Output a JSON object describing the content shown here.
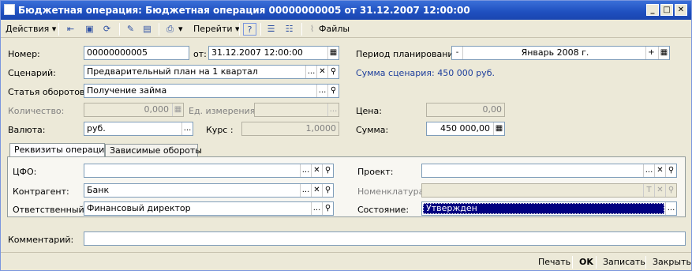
{
  "window": {
    "title": "Бюджетная операция: Бюджетная операция 00000000005 от 31.12.2007 12:00:00"
  },
  "toolbar": {
    "actions_label": "Действия",
    "goto_label": "Перейти",
    "files_label": "Файлы",
    "help_label": "?"
  },
  "fields": {
    "number_label": "Номер:",
    "number_value": "00000000005",
    "date_label": "от:",
    "date_value": "31.12.2007 12:00:00",
    "period_label": "Период планирования:",
    "period_value": "Январь 2008 г.",
    "scenario_label": "Сценарий:",
    "scenario_value": "Предварительный план на 1 квартал",
    "scenario_sum": "Сумма сценария: 450 000 руб.",
    "article_label": "Статья оборотов:",
    "article_value": "Получение займа",
    "qty_label": "Количество:",
    "qty_value": "0,000",
    "unit_label": "Ед. измерения:",
    "unit_value": "",
    "price_label": "Цена:",
    "price_value": "0,00",
    "currency_label": "Валюта:",
    "currency_value": "руб.",
    "rate_label": "Курс :",
    "rate_value": "1,0000",
    "sum_label": "Сумма:",
    "sum_value": "450 000,00"
  },
  "tabs": [
    {
      "label": "Реквизиты операции"
    },
    {
      "label": "Зависимые обороты"
    }
  ],
  "panel": {
    "cfo_label": "ЦФО:",
    "cfo_value": "",
    "project_label": "Проект:",
    "project_value": "",
    "contractor_label": "Контрагент:",
    "contractor_value": "Банк",
    "nomenclature_label": "Номенклатура:",
    "nomenclature_value": "",
    "responsible_label": "Ответственный:",
    "responsible_value": "Финансовый директор",
    "state_label": "Состояние:",
    "state_value": "Утвержден"
  },
  "comment": {
    "label": "Комментарий:",
    "value": ""
  },
  "buttons": {
    "print": "Печать",
    "ok": "OK",
    "save": "Записать",
    "close": "Закрыть"
  }
}
